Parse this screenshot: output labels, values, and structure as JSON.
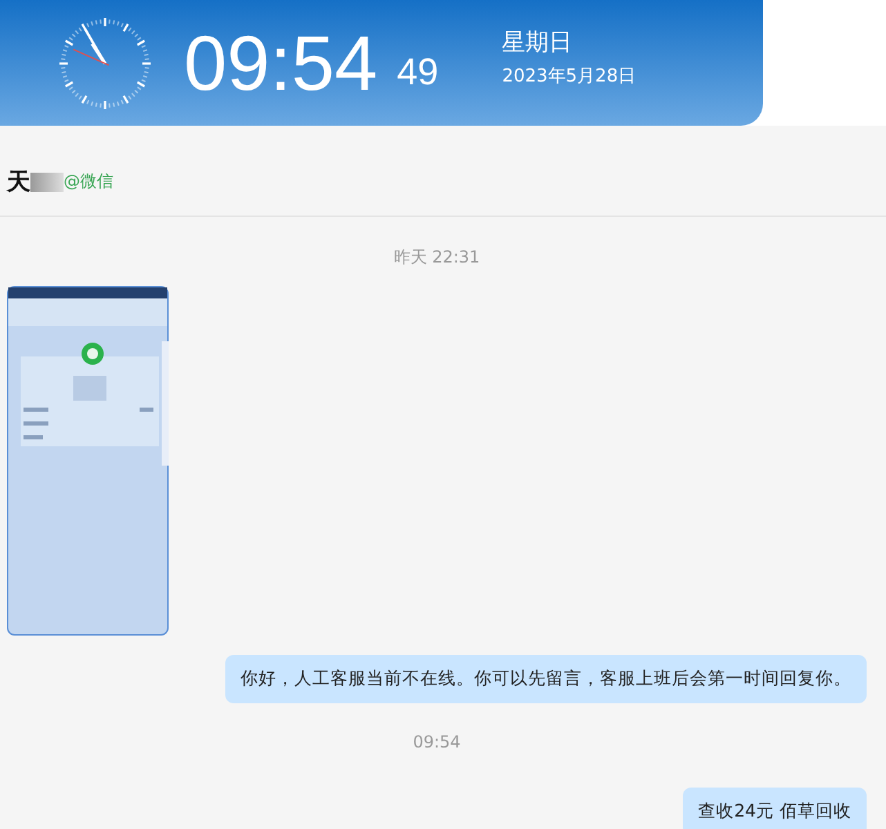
{
  "header": {
    "time": "09:54",
    "seconds": "49",
    "weekday": "星期日",
    "date": "2023年5月28日"
  },
  "contact": {
    "name": "天",
    "source": "@微信"
  },
  "messages": [
    {
      "kind": "timestamp",
      "text": "昨天 22:31"
    },
    {
      "kind": "picture"
    },
    {
      "kind": "bubble",
      "text": "你好，人工客服当前不在线。你可以先留言，客服上班后会第一时间回复你。"
    },
    {
      "kind": "timestamp",
      "text": "09:54"
    },
    {
      "kind": "bubble",
      "text": "查收24元  佰草回收"
    }
  ]
}
